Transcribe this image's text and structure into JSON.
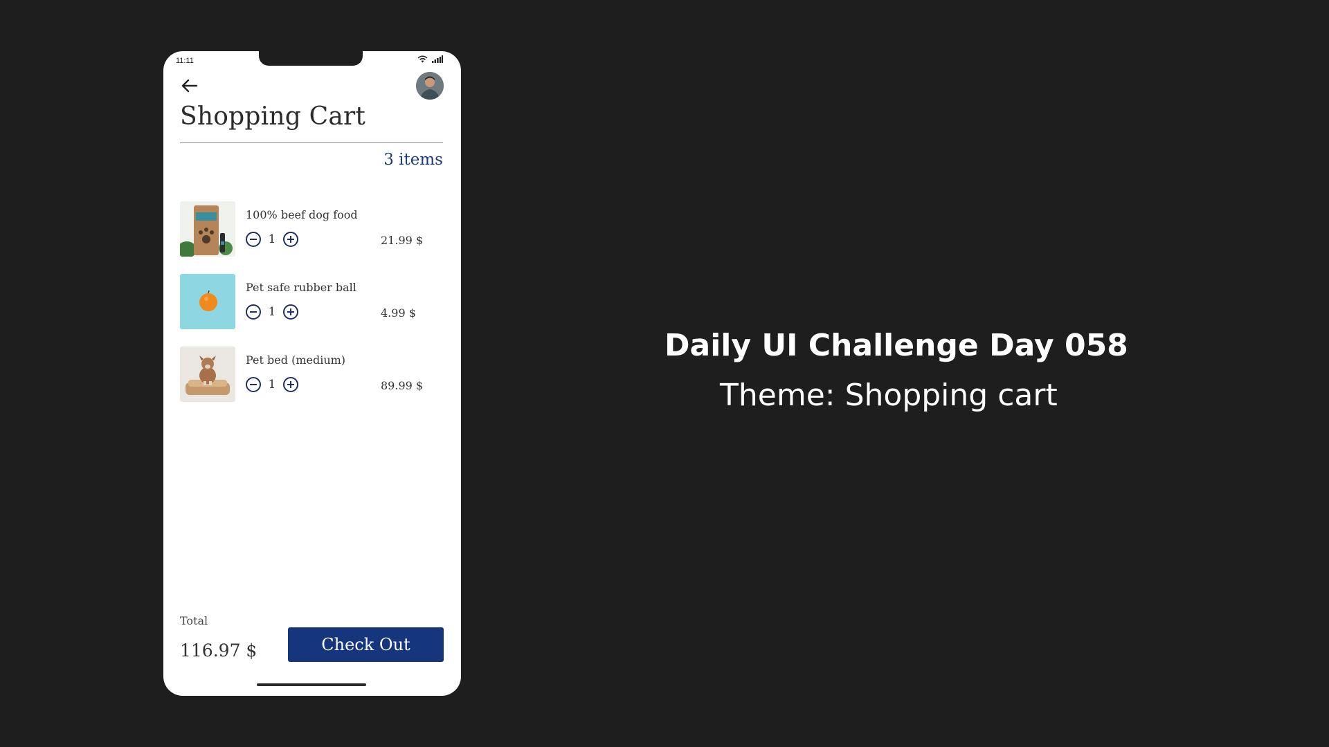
{
  "status_bar": {
    "time": "11:11",
    "wifi_icon": "wifi-icon",
    "signal_icon": "cellular-signal-icon"
  },
  "header": {
    "back_icon": "arrow-left-icon",
    "avatar": "user-avatar",
    "title": "Shopping Cart",
    "items_count": "3 items"
  },
  "cart": {
    "items": [
      {
        "name": "100% beef dog food",
        "quantity": "1",
        "price": "21.99 $",
        "thumb": "dog-food-bag-image"
      },
      {
        "name": "Pet safe rubber ball",
        "quantity": "1",
        "price": "4.99 $",
        "thumb": "orange-ball-image"
      },
      {
        "name": "Pet bed (medium)",
        "quantity": "1",
        "price": "89.99 $",
        "thumb": "dog-on-bed-image"
      }
    ],
    "decrease_icon": "minus-circle-icon",
    "increase_icon": "plus-circle-icon"
  },
  "footer": {
    "total_label": "Total",
    "total_value": "116.97 $",
    "checkout_label": "Check Out"
  },
  "caption": {
    "title": "Daily UI Challenge Day 058",
    "subtitle": "Theme: Shopping cart"
  },
  "colors": {
    "background": "#1e1e1e",
    "phone_bg": "#ffffff",
    "accent": "#15357c",
    "items_count": "#1d3a7c",
    "ball_bg": "#8fd6e3",
    "ball": "#f08a1c"
  }
}
